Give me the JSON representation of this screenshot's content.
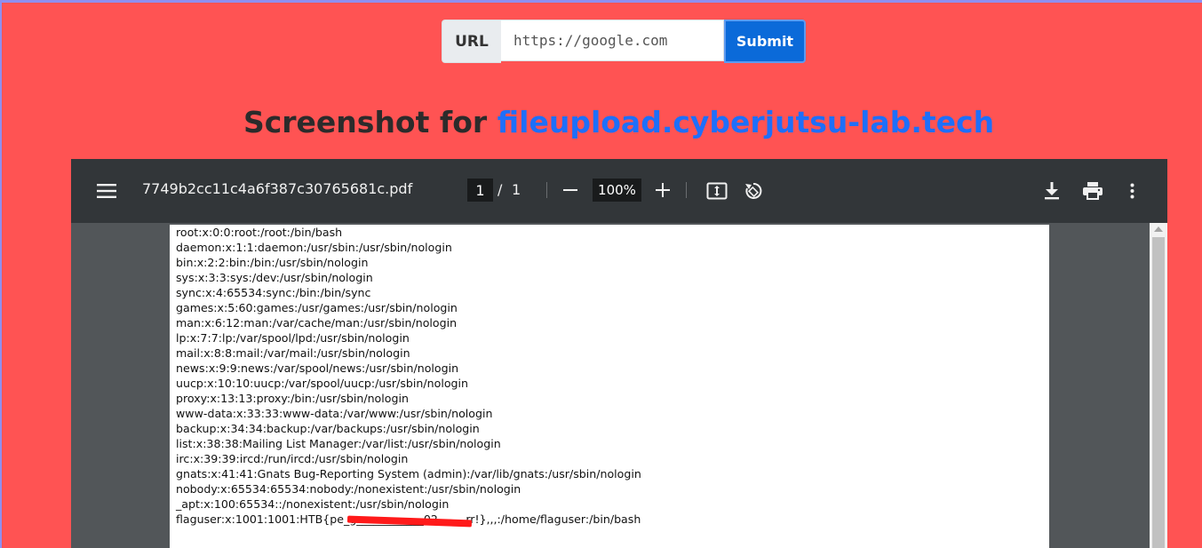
{
  "form": {
    "label": "URL",
    "url_placeholder": "https://google.com",
    "submit_label": "Submit"
  },
  "heading": {
    "prefix": "Screenshot for",
    "host": "fileupload.cyberjutsu-lab.tech"
  },
  "viewer": {
    "filename": "7749b2cc11c4a6f387c30765681c.pdf",
    "page_current": "1",
    "page_separator": "/",
    "page_total": "1",
    "zoom": "100%",
    "icons": [
      "menu-icon",
      "zoom-out-icon",
      "zoom-in-icon",
      "fit-page-icon",
      "rotate-icon",
      "download-icon",
      "print-icon",
      "more-options-icon"
    ]
  },
  "pdf_lines": [
    "root:x:0:0:root:/root:/bin/bash",
    "daemon:x:1:1:daemon:/usr/sbin:/usr/sbin/nologin",
    "bin:x:2:2:bin:/bin:/usr/sbin/nologin",
    "sys:x:3:3:sys:/dev:/usr/sbin/nologin",
    "sync:x:4:65534:sync:/bin:/bin/sync",
    "games:x:5:60:games:/usr/games:/usr/sbin/nologin",
    "man:x:6:12:man:/var/cache/man:/usr/sbin/nologin",
    "lp:x:7:7:lp:/var/spool/lpd:/usr/sbin/nologin",
    "mail:x:8:8:mail:/var/mail:/usr/sbin/nologin",
    "news:x:9:9:news:/var/spool/news:/usr/sbin/nologin",
    "uucp:x:10:10:uucp:/var/spool/uucp:/usr/sbin/nologin",
    "proxy:x:13:13:proxy:/bin:/usr/sbin/nologin",
    "www-data:x:33:33:www-data:/var/www:/usr/sbin/nologin",
    "backup:x:34:34:backup:/var/backups:/usr/sbin/nologin",
    "list:x:38:38:Mailing List Manager:/var/list:/usr/sbin/nologin",
    "irc:x:39:39:ircd:/run/ircd:/usr/sbin/nologin",
    "gnats:x:41:41:Gnats Bug-Reporting System (admin):/var/lib/gnats:/usr/sbin/nologin",
    "nobody:x:65534:65534:nobody:/nonexistent:/usr/sbin/nologin",
    "_apt:x:100:65534::/nonexistent:/usr/sbin/nologin",
    "flaguser:x:1001:1001:HTB{pe_g____________02_____rr!},,,:/home/flaguser:/bin/bash"
  ],
  "colors": {
    "page_background": "#ff5353",
    "toolbar": "#323639",
    "viewer_background": "#525659",
    "submit": "#0b6ad9",
    "host_link": "#1e6ffa",
    "redaction": "#ff1a1a"
  }
}
